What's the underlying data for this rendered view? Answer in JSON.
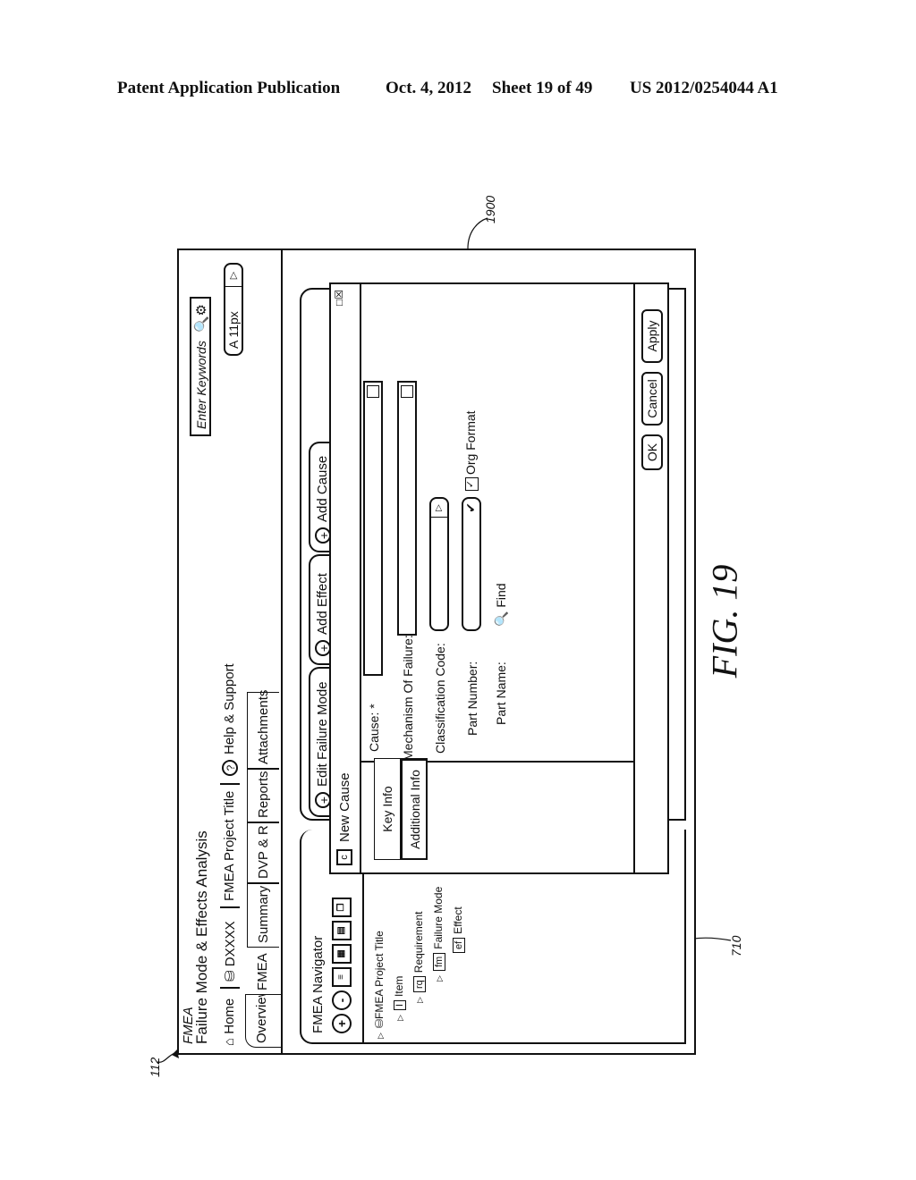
{
  "header": {
    "publication": "Patent Application Publication",
    "date": "Oct. 4, 2012",
    "sheet": "Sheet 19 of 49",
    "number": "US 2012/0254044 A1"
  },
  "figure_label": "FIG. 19",
  "reference_labels": {
    "frame": "1900",
    "app": "112",
    "panel": "710"
  },
  "app": {
    "title_small": "FMEA",
    "title": "Failure Mode & Effects Analysis",
    "nav": {
      "home": "Home",
      "db": "DXXXX",
      "project": "FMEA Project Title",
      "help": "Help & Support"
    },
    "search": {
      "placeholder": "Enter Keywords"
    },
    "font_selector": {
      "value": "A 11px"
    },
    "tabs": [
      "Overview",
      "FMEA",
      "Summary",
      "DVP & R",
      "Reports",
      "Attachments"
    ],
    "active_tab": "Overview"
  },
  "navigator": {
    "title": "FMEA Navigator",
    "tree": [
      {
        "label": "FMEA Project Title",
        "icon": "database"
      },
      {
        "label": "Item",
        "badge": "I"
      },
      {
        "label": "Requirement",
        "badge": "rq"
      },
      {
        "label": "Failure Mode",
        "badge": "fm"
      },
      {
        "label": "Effect",
        "badge": "ef"
      }
    ]
  },
  "actions": {
    "edit_failure_mode": "Edit Failure Mode",
    "add_effect": "Add Effect",
    "add_cause": "Add Cause"
  },
  "dialog": {
    "icon": "c",
    "title": "New Cause",
    "side_tabs": [
      "Key Info",
      "Additional Info"
    ],
    "fields": {
      "cause": "Cause: *",
      "mechanism": "Mechanism Of Failure:",
      "classification": "Classification Code:",
      "part_number": "Part Number:",
      "part_name": "Part Name:"
    },
    "org_format": {
      "label": "Org Format",
      "checked": true
    },
    "find": "Find",
    "buttons": {
      "ok": "OK",
      "cancel": "Cancel",
      "apply": "Apply"
    }
  }
}
